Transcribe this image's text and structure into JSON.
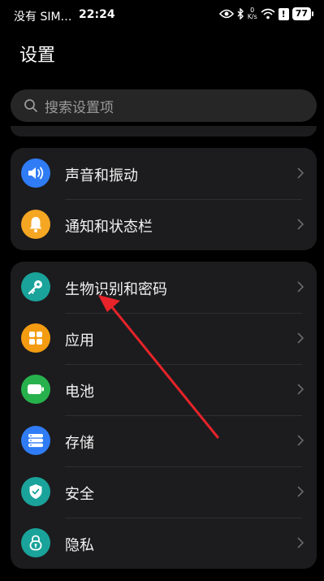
{
  "status_bar": {
    "carrier": "没有 SIM…",
    "time": "22:24",
    "speed_top": "0",
    "speed_unit": "K/s",
    "battery": "77",
    "warning": "!"
  },
  "header": {
    "title": "设置"
  },
  "search": {
    "placeholder": "搜索设置项"
  },
  "groups": [
    {
      "items": [
        {
          "label": "声音和振动",
          "icon": "speaker-icon",
          "color": "#2f7cf6"
        },
        {
          "label": "通知和状态栏",
          "icon": "bell-icon",
          "color": "#f5a623"
        }
      ]
    },
    {
      "items": [
        {
          "label": "生物识别和密码",
          "icon": "key-icon",
          "color": "#1aa39a"
        },
        {
          "label": "应用",
          "icon": "apps-grid-icon",
          "color": "#f39c12"
        },
        {
          "label": "电池",
          "icon": "battery-icon",
          "color": "#27b14c"
        },
        {
          "label": "存储",
          "icon": "storage-icon",
          "color": "#2f7cf6"
        },
        {
          "label": "安全",
          "icon": "shield-icon",
          "color": "#1aa39a"
        },
        {
          "label": "隐私",
          "icon": "lock-icon",
          "color": "#1aa39a"
        }
      ]
    }
  ],
  "annotation": {
    "color": "#e8232a"
  }
}
